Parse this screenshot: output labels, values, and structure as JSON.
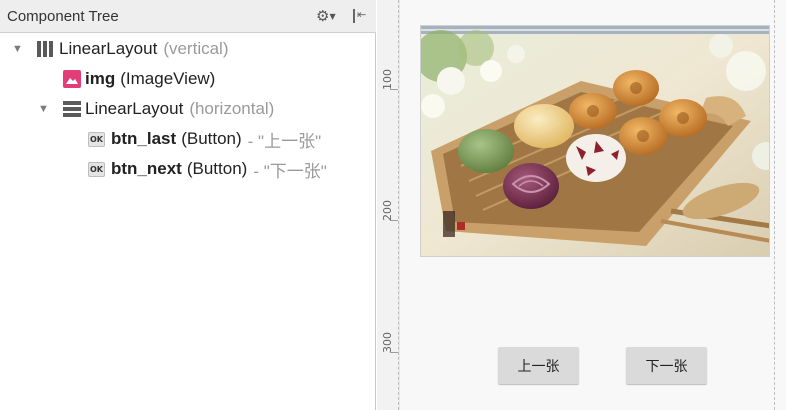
{
  "panel": {
    "title": "Component Tree",
    "header_icons": [
      "gear-icon",
      "collapse-panel-icon"
    ]
  },
  "tree": [
    {
      "id": "root",
      "icon": "vertical-linearlayout-icon",
      "name": "LinearLayout",
      "type": "(vertical)",
      "hint": "",
      "expanded": true
    },
    {
      "id": "img",
      "icon": "imageview-icon",
      "name": "img",
      "type": "(ImageView)",
      "hint": ""
    },
    {
      "id": "row",
      "icon": "horizontal-linearlayout-icon",
      "name": "LinearLayout",
      "type": "(horizontal)",
      "hint": "",
      "expanded": true
    },
    {
      "id": "btn_last",
      "icon": "button-icon",
      "name": "btn_last",
      "type": "(Button)",
      "hint": "- \"上一张\""
    },
    {
      "id": "btn_next",
      "icon": "button-icon",
      "name": "btn_next",
      "type": "(Button)",
      "hint": "- \"下一张\""
    }
  ],
  "ruler": {
    "labels": [
      "100",
      "200",
      "300"
    ]
  },
  "preview": {
    "image_subject": "mooncakes-on-wooden-tray",
    "buttons": {
      "prev_label": "上一张",
      "next_label": "下一张"
    }
  },
  "colors": {
    "imageview_icon": "#e33d78",
    "button_bg": "#dadada",
    "panel_header": "#eeeeee",
    "canvas": "#f8f8f8"
  }
}
